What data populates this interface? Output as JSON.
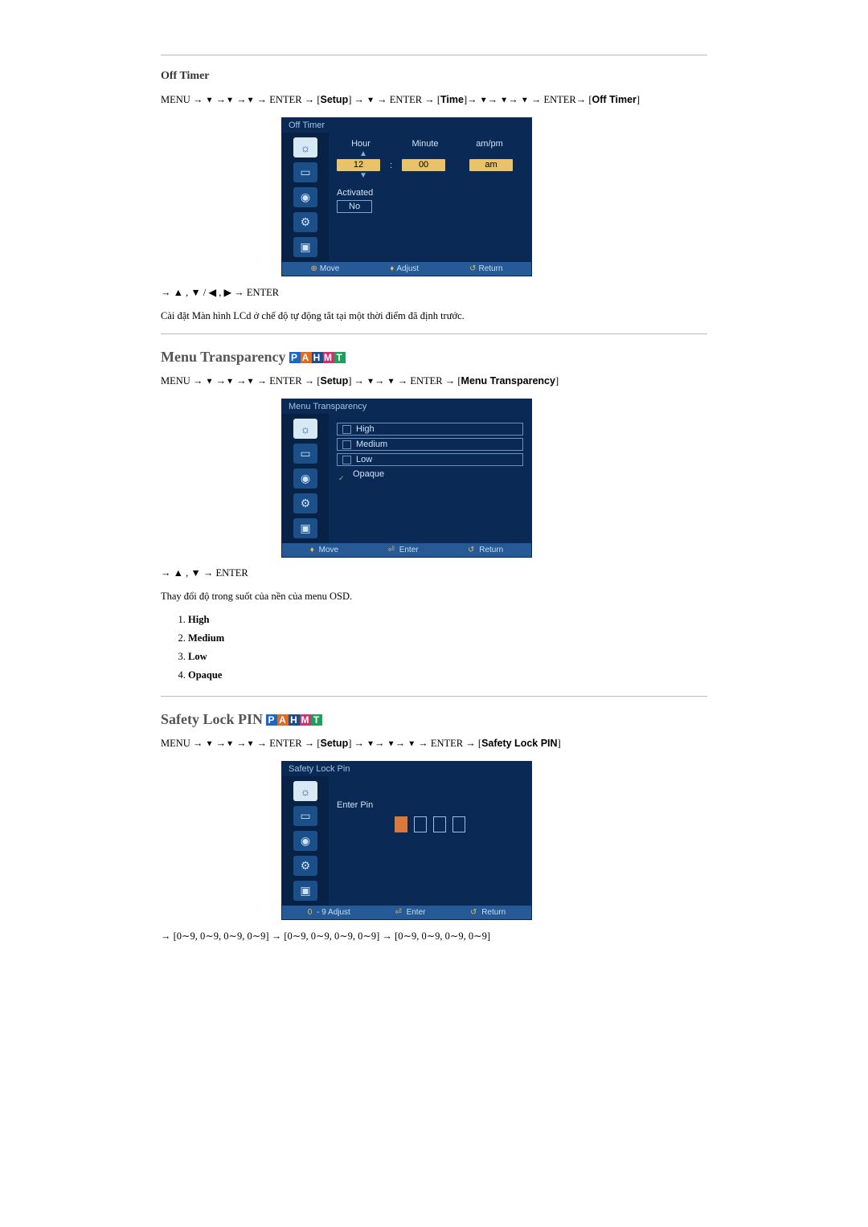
{
  "sections": {
    "off_timer": {
      "title": "Off Timer",
      "path_parts": {
        "menu": "MENU",
        "enter": "ENTER",
        "setup": "Setup",
        "time": "Time",
        "target": "Off Timer"
      },
      "osd": {
        "title": "Off Timer",
        "labels": {
          "hour": "Hour",
          "minute": "Minute",
          "ampm": "am/pm"
        },
        "values": {
          "hour": "12",
          "minute": "00",
          "ampm": "am"
        },
        "activated_label": "Activated",
        "activated_value": "No",
        "footer": {
          "move": "Move",
          "adjust": "Adjust",
          "return": "Return"
        }
      },
      "nav_line": "→ ▲ , ▼ / ◀ , ▶ → ENTER",
      "description": "Cài đặt Màn hình LCd ở chế độ tự động tắt tại một thời điểm đã định trước."
    },
    "menu_transparency": {
      "title": "Menu Transparency",
      "path_parts": {
        "menu": "MENU",
        "enter": "ENTER",
        "setup": "Setup",
        "target": "Menu Transparency"
      },
      "osd": {
        "title": "Menu Transparency",
        "options": [
          "High",
          "Medium",
          "Low",
          "Opaque"
        ],
        "selected_index": 3,
        "footer": {
          "move": "Move",
          "enter": "Enter",
          "return": "Return"
        }
      },
      "nav_line": "→ ▲ , ▼ → ENTER",
      "description": "Thay đổi độ trong suốt của nền của menu OSD.",
      "list": [
        "High",
        "Medium",
        "Low",
        "Opaque"
      ]
    },
    "safety_lock": {
      "title": "Safety Lock PIN",
      "path_parts": {
        "menu": "MENU",
        "enter": "ENTER",
        "setup": "Setup",
        "target": "Safety Lock PIN"
      },
      "osd": {
        "title": "Safety Lock Pin",
        "prompt": "Enter Pin",
        "footer": {
          "adjust_prefix": "0",
          "adjust_suffix": "9 Adjust",
          "enter": "Enter",
          "return": "Return"
        }
      },
      "pin_line": "→ [0∼9, 0∼9, 0∼9, 0∼9] → [0∼9, 0∼9, 0∼9, 0∼9] → [0∼9, 0∼9, 0∼9, 0∼9]"
    }
  },
  "icons": {
    "star": "☼",
    "slider": "▭",
    "circle": "◉",
    "gear": "⚙",
    "picture": "▣"
  }
}
